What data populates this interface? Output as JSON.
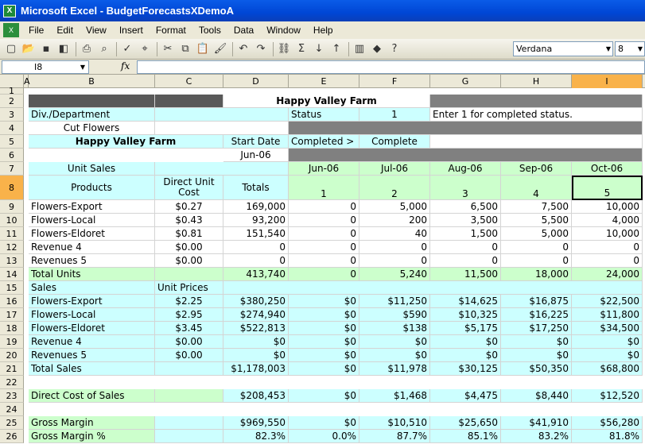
{
  "window": {
    "title": "Microsoft Excel - BudgetForecastsXDemoA"
  },
  "menu": [
    "File",
    "Edit",
    "View",
    "Insert",
    "Format",
    "Tools",
    "Data",
    "Window",
    "Help"
  ],
  "toolbar": {
    "font": "Verdana",
    "size": "8"
  },
  "formula_bar": {
    "name_box": "I8",
    "fx": "fx",
    "value": ""
  },
  "columns": [
    "A",
    "B",
    "C",
    "D",
    "E",
    "F",
    "G",
    "H",
    "I"
  ],
  "rows": [
    "1",
    "2",
    "3",
    "4",
    "5",
    "6",
    "7",
    "8",
    "9",
    "10",
    "11",
    "12",
    "13",
    "14",
    "15",
    "16",
    "17",
    "18",
    "19",
    "20",
    "21",
    "22",
    "23",
    "24",
    "25",
    "26"
  ],
  "sheet": {
    "title": "Happy Valley Farm",
    "div_label": "Div./Department",
    "status_label": "Status",
    "status_value": "1",
    "status_note": "Enter 1 for completed status.",
    "dept": "Cut Flowers",
    "company": "Happy Valley Farm",
    "start_date_label": "Start Date",
    "completed_label": "Completed >",
    "complete_value": "Complete",
    "start_date": "Jun-06",
    "unit_sales": "Unit Sales",
    "months": [
      "Jun-06",
      "Jul-06",
      "Aug-06",
      "Sep-06",
      "Oct-06"
    ],
    "products_hdr": "Products",
    "direct_cost_hdr": "Direct Unit Cost",
    "totals_hdr": "Totals",
    "period_nums": [
      "1",
      "2",
      "3",
      "4",
      "5"
    ],
    "unit_rows": [
      {
        "name": "Flowers-Export",
        "cost": "$0.27",
        "total": "169,000",
        "vals": [
          "0",
          "5,000",
          "6,500",
          "7,500",
          "10,000"
        ]
      },
      {
        "name": "Flowers-Local",
        "cost": "$0.43",
        "total": "93,200",
        "vals": [
          "0",
          "200",
          "3,500",
          "5,500",
          "4,000"
        ]
      },
      {
        "name": "Flowers-Eldoret",
        "cost": "$0.81",
        "total": "151,540",
        "vals": [
          "0",
          "40",
          "1,500",
          "5,000",
          "10,000"
        ]
      },
      {
        "name": "Revenue 4",
        "cost": "$0.00",
        "total": "0",
        "vals": [
          "0",
          "0",
          "0",
          "0",
          "0"
        ]
      },
      {
        "name": "Revenues 5",
        "cost": "$0.00",
        "total": "0",
        "vals": [
          "0",
          "0",
          "0",
          "0",
          "0"
        ]
      }
    ],
    "total_units": {
      "name": "Total Units",
      "total": "413,740",
      "vals": [
        "0",
        "5,240",
        "11,500",
        "18,000",
        "24,000"
      ]
    },
    "sales_label": "Sales",
    "unit_prices_label": "Unit Prices",
    "sales_rows": [
      {
        "name": "Flowers-Export",
        "price": "$2.25",
        "total": "$380,250",
        "vals": [
          "$0",
          "$11,250",
          "$14,625",
          "$16,875",
          "$22,500"
        ]
      },
      {
        "name": "Flowers-Local",
        "price": "$2.95",
        "total": "$274,940",
        "vals": [
          "$0",
          "$590",
          "$10,325",
          "$16,225",
          "$11,800"
        ]
      },
      {
        "name": "Flowers-Eldoret",
        "price": "$3.45",
        "total": "$522,813",
        "vals": [
          "$0",
          "$138",
          "$5,175",
          "$17,250",
          "$34,500"
        ]
      },
      {
        "name": "Revenue 4",
        "price": "$0.00",
        "total": "$0",
        "vals": [
          "$0",
          "$0",
          "$0",
          "$0",
          "$0"
        ]
      },
      {
        "name": "Revenues 5",
        "price": "$0.00",
        "total": "$0",
        "vals": [
          "$0",
          "$0",
          "$0",
          "$0",
          "$0"
        ]
      }
    ],
    "total_sales": {
      "name": "Total Sales",
      "total": "$1,178,003",
      "vals": [
        "$0",
        "$11,978",
        "$30,125",
        "$50,350",
        "$68,800"
      ]
    },
    "dcos": {
      "name": "Direct Cost of Sales",
      "total": "$208,453",
      "vals": [
        "$0",
        "$1,468",
        "$4,475",
        "$8,440",
        "$12,520"
      ]
    },
    "gm": {
      "name": "Gross Margin",
      "total": "$969,550",
      "vals": [
        "$0",
        "$10,510",
        "$25,650",
        "$41,910",
        "$56,280"
      ]
    },
    "gmp": {
      "name": "Gross Margin %",
      "total": "82.3%",
      "vals": [
        "0.0%",
        "87.7%",
        "85.1%",
        "83.2%",
        "81.8%"
      ]
    }
  },
  "colors": {
    "cyan": "#ccffff",
    "green": "#ccffcc",
    "gray": "#808080",
    "dark_gray": "#595959",
    "title_bar": "#0046d5",
    "selected_header": "#f9b24a"
  }
}
